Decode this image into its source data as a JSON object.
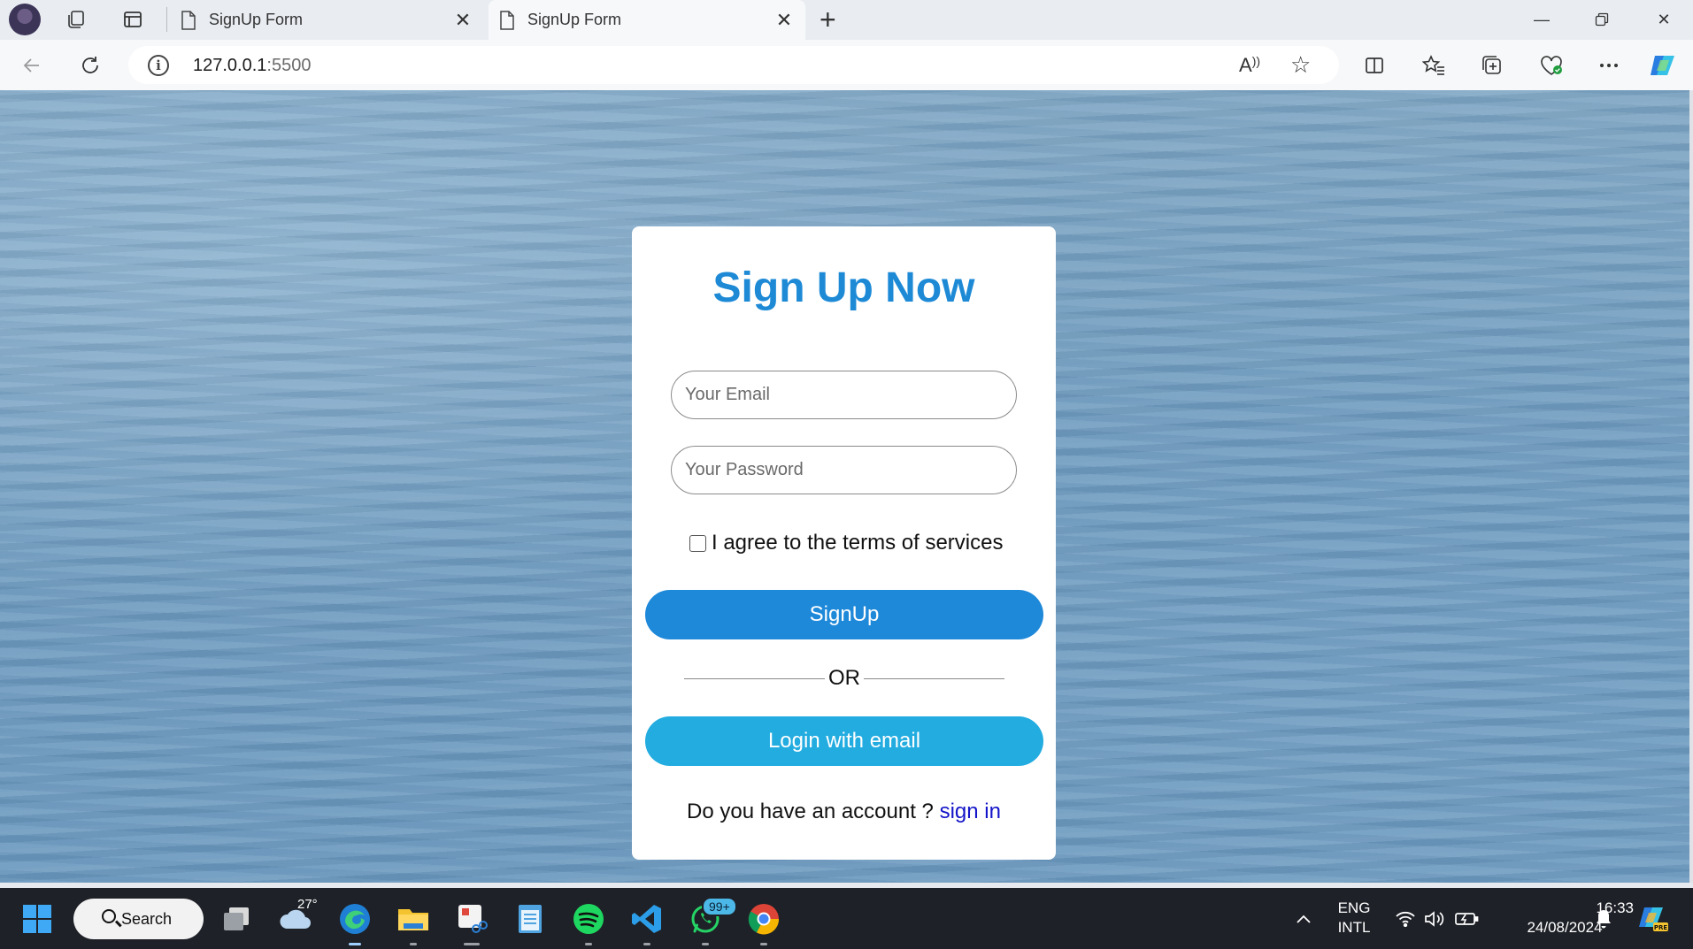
{
  "browser": {
    "tabs": [
      {
        "title": "SignUp Form",
        "active": false
      },
      {
        "title": "SignUp Form",
        "active": true
      }
    ],
    "address": {
      "host": "127.0.0.1",
      "port": ":5500"
    }
  },
  "form": {
    "heading": "Sign Up Now",
    "email_placeholder": "Your Email",
    "password_placeholder": "Your Password",
    "terms_label": "I agree to the terms of services",
    "terms_checked": false,
    "signup_label": "SignUp",
    "or_label": "OR",
    "login_label": "Login with email",
    "account_question": "Do you have an account ? ",
    "signin_link": "sign in"
  },
  "taskbar": {
    "search_label": "Search",
    "weather_temp": "27°",
    "whatsapp_badge": "99+",
    "language": "ENG",
    "layout": "INTL",
    "time": "16:33",
    "date": "24/08/2024"
  },
  "colors": {
    "heading": "#1e8ad6",
    "signup_button": "#1e88d9",
    "login_button": "#22ace0",
    "signin_link": "#1414c9"
  }
}
